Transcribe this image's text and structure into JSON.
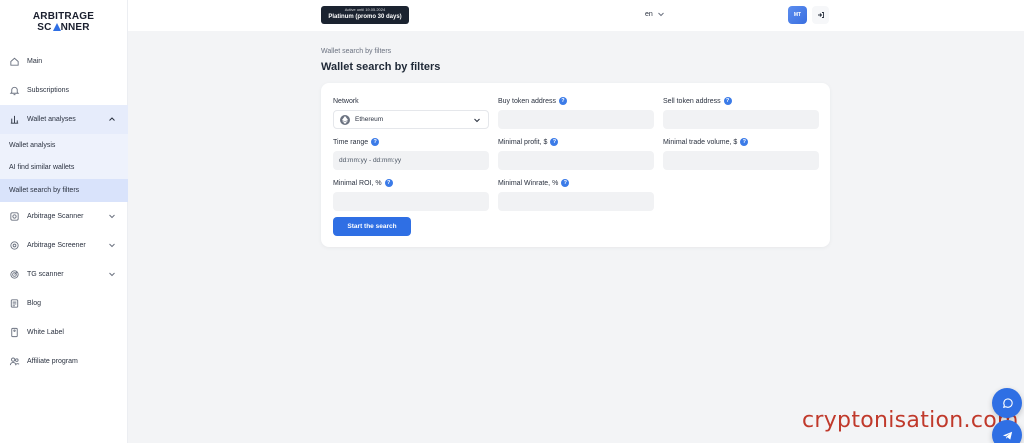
{
  "logo": {
    "line1": "ARBITRAGE",
    "line2a": "SC",
    "line2b": "NNER"
  },
  "sidebar": {
    "items": [
      {
        "label": "Main",
        "icon": "home-icon"
      },
      {
        "label": "Subscriptions",
        "icon": "bell-icon"
      },
      {
        "label": "Wallet analyses",
        "icon": "chart-icon"
      },
      {
        "label": "Arbitrage Scanner",
        "icon": "scan-icon"
      },
      {
        "label": "Arbitrage Screener",
        "icon": "settings-icon"
      },
      {
        "label": "TG scanner",
        "icon": "radar-icon"
      },
      {
        "label": "Blog",
        "icon": "document-icon"
      },
      {
        "label": "White Label",
        "icon": "tag-icon"
      },
      {
        "label": "Affiliate program",
        "icon": "users-icon"
      }
    ],
    "submenu": [
      {
        "label": "Wallet analysis"
      },
      {
        "label": "AI find similar wallets"
      },
      {
        "label": "Wallet search by filters"
      }
    ]
  },
  "topbar": {
    "plan_note": "Active until 19.05.2024",
    "plan_label": "Platinum (promo 30 days)",
    "language": "en",
    "avatar_initials": "MT"
  },
  "page": {
    "breadcrumb": "Wallet search by filters",
    "title": "Wallet search by filters"
  },
  "form": {
    "network_label": "Network",
    "network_value": "Ethereum",
    "buy_token_label": "Buy token address",
    "sell_token_label": "Sell token address",
    "time_range_label": "Time range",
    "time_range_placeholder": "dd:mm:yy - dd:mm:yy",
    "min_profit_label": "Minimal profit, $",
    "min_volume_label": "Minimal trade volume, $",
    "min_roi_label": "Minimal ROI, %",
    "min_winrate_label": "Minimal Winrate, %",
    "search_button": "Start the search"
  },
  "watermark": "cryptonisation.com",
  "colors": {
    "accent": "#2f6fe4",
    "sidebar_active": "#d9e3fb",
    "plan_badge": "#1b2330"
  }
}
